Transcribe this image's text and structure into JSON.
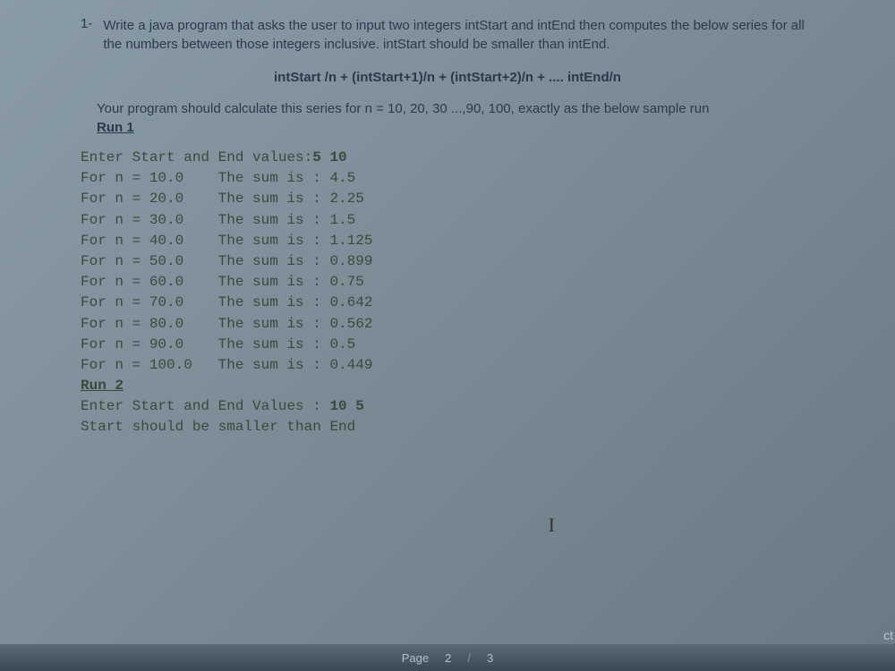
{
  "question": {
    "number": "1-",
    "text": "Write a java program that asks the user to input two integers intStart and intEnd then computes the below series for all the numbers between those integers inclusive. intStart should be smaller than intEnd."
  },
  "formula": "intStart /n + (intStart+1)/n + (intStart+2)/n + .... intEnd/n",
  "instruction": "Your program should calculate this series for n = 10, 20, 30 ...,90, 100, exactly as the below sample run",
  "run1_label": "Run 1",
  "console": {
    "prompt1": "Enter Start and End values:",
    "input1": "5 10",
    "rows": [
      {
        "n": "10.0",
        "sum": "4.5"
      },
      {
        "n": "20.0",
        "sum": "2.25"
      },
      {
        "n": "30.0",
        "sum": "1.5"
      },
      {
        "n": "40.0",
        "sum": "1.125"
      },
      {
        "n": "50.0",
        "sum": "0.899"
      },
      {
        "n": "60.0",
        "sum": "0.75"
      },
      {
        "n": "70.0",
        "sum": "0.642"
      },
      {
        "n": "80.0",
        "sum": "0.562"
      },
      {
        "n": "90.0",
        "sum": "0.5"
      },
      {
        "n": "100.0",
        "sum": "0.449"
      }
    ],
    "run2_label": "Run 2",
    "prompt2": "Enter Start and End Values :",
    "input2": "10 5",
    "error": "Start should be smaller than End"
  },
  "cursor": "I",
  "footer": {
    "page_label": "Page",
    "current": "2",
    "sep": "/",
    "total": "3"
  },
  "ct": "ct"
}
